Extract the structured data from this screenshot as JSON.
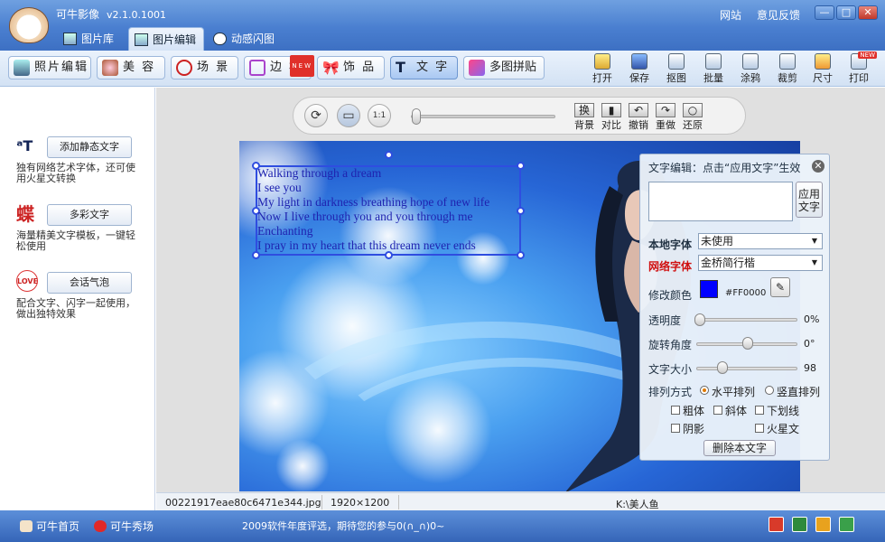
{
  "app": {
    "title": "可牛影像",
    "version": "v2.1.0.1001",
    "main_tabs": [
      "图片库",
      "图片编辑",
      "动感闪图"
    ],
    "top_links": [
      "网站",
      "意见反馈"
    ]
  },
  "toolbar": {
    "tools": [
      "照片编辑",
      "美 容",
      "场 景",
      "边 框",
      "饰 品",
      "文 字",
      "多图拼贴"
    ],
    "active_tool": "文 字",
    "actions": [
      "打开",
      "保存",
      "抠图",
      "批量",
      "涂鸦",
      "裁剪",
      "尺寸",
      "打印"
    ],
    "new_badge": "NEW"
  },
  "left_panel": {
    "items": [
      {
        "button": "添加静态文字",
        "desc": "独有网络艺术字体，还可使用火星文转换"
      },
      {
        "button": "多彩文字",
        "desc": "海量精美文字模板，一键轻松使用"
      },
      {
        "button": "会话气泡",
        "desc": "配合文字、闪字一起使用，做出独特效果"
      }
    ]
  },
  "controls": {
    "zoom_11": "1:1",
    "side_buttons": [
      "背景",
      "对比",
      "撤销",
      "重做",
      "还原"
    ],
    "side_icons": [
      "换",
      "▮",
      "↶",
      "↷",
      "○"
    ]
  },
  "canvas": {
    "text_lines": [
      "Walking through a dream",
      "I see you",
      "My light in darkness breathing hope of new life",
      "Now I live through you and you through me",
      "Enchanting",
      "I pray in my heart that this dream never ends"
    ],
    "text_color": "#1f23b0"
  },
  "text_panel": {
    "title": "文字编辑：点击“应用文字”生效",
    "apply_button": "应用文字",
    "local_font_label": "本地字体",
    "local_font_value": "未使用",
    "web_font_label": "网络字体",
    "web_font_value": "金桥简行楷",
    "color_label": "修改颜色",
    "color_value": "#FF0000",
    "swatch_color": "#0000ff",
    "opacity_label": "透明度",
    "opacity_value": "0%",
    "rotate_label": "旋转角度",
    "rotate_value": "0°",
    "size_label": "文字大小",
    "size_value": "98",
    "layout_label": "排列方式",
    "layout_options": [
      "水平排列",
      "竖直排列"
    ],
    "layout_selected": "水平排列",
    "styles": [
      "粗体",
      "斜体",
      "下划线",
      "阴影",
      "火星文"
    ],
    "delete_button": "删除本文字"
  },
  "info_bar": {
    "filename": "00221917eae80c6471e344.jpg",
    "dimensions": "1920×1200",
    "path": "K:\\美人鱼"
  },
  "status_bar": {
    "links": [
      "可牛首页",
      "可牛秀场"
    ],
    "message": "2009软件年度评选，期待您的参与0(∩_∩)0~"
  }
}
